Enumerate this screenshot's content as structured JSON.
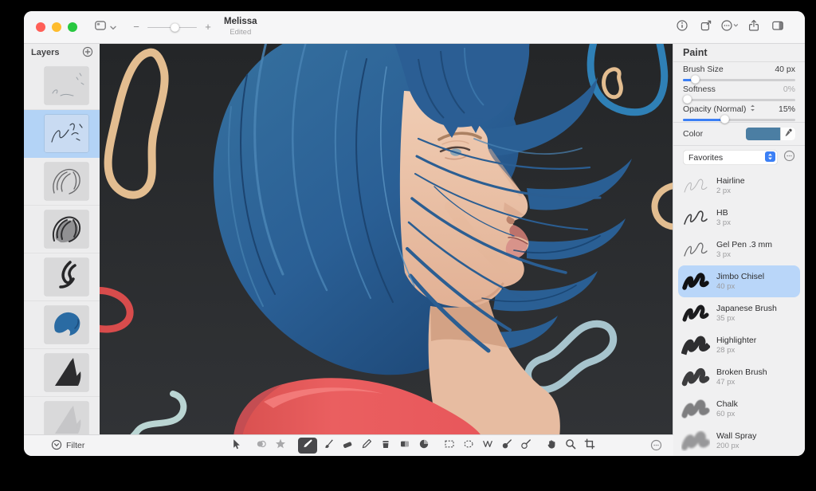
{
  "colors": {
    "accent": "#3b7ff5",
    "selection": "#b9d6f9",
    "layer_selection": "#b3d3f6",
    "swatch": "#4b7ea3",
    "canvas_bg": "#2a2c2e",
    "hair_blue": "#2d659c",
    "skin": "#ecc7ae",
    "shirt_red": "#e85a5c",
    "ring_tan": "#e3bd90",
    "ring_blue": "#2f80b6",
    "ring_red": "#d84c4c",
    "ring_lightblue": "#a7c4cd",
    "ring_teal": "#bad5d3"
  },
  "titlebar": {
    "title": "Melissa",
    "status": "Edited",
    "left_icons": [
      "view-options",
      "chevron-down"
    ],
    "zoom": {
      "minus": "−",
      "plus": "+",
      "level_pct": 57
    },
    "right_icons": [
      "info",
      "duplicate",
      "more-options",
      "share",
      "sidebar-toggle"
    ]
  },
  "layers_panel": {
    "header": "Layers",
    "add_icon": "plus-circle",
    "items": [
      {
        "thumb": "sketch-faint",
        "selected": false
      },
      {
        "thumb": "sketch-hair",
        "selected": true
      },
      {
        "thumb": "hair-line-art",
        "selected": false
      },
      {
        "thumb": "hair-dark-art",
        "selected": false
      },
      {
        "thumb": "stroke-swirl",
        "selected": false
      },
      {
        "thumb": "hair-fill-blue",
        "selected": false
      },
      {
        "thumb": "shape-dark",
        "selected": false
      },
      {
        "thumb": "shape-light",
        "selected": false
      }
    ]
  },
  "canvas": {
    "description": "Digital painting: woman in right-facing profile with blue bob haircut and red shirt on dark charcoal background, surrounded by decorative hand-drawn loops (tan, blue, red, light blue, teal)"
  },
  "inspector": {
    "header": "Paint",
    "controls": [
      {
        "label": "Brush Size",
        "value": "40 px",
        "pct": 8,
        "muted_value": false,
        "stepper": false
      },
      {
        "label": "Softness",
        "value": "0%",
        "pct": 0,
        "muted_value": true,
        "stepper": false
      },
      {
        "label": "Opacity (Normal)",
        "value": "15%",
        "pct": 36,
        "muted_value": false,
        "stepper": true
      }
    ],
    "color": {
      "label": "Color",
      "eyedropper_icon": "eyedropper"
    },
    "favorites": {
      "label": "Favorites",
      "stepper_icon": "select-stepper",
      "more_icon": "ellipsis-circle"
    },
    "brushes": [
      {
        "name": "Hairline",
        "size": "2 px",
        "style": "hairline",
        "selected": false
      },
      {
        "name": "HB",
        "size": "3 px",
        "style": "hb",
        "selected": false
      },
      {
        "name": "Gel Pen .3 mm",
        "size": "3 px",
        "style": "gel",
        "selected": false
      },
      {
        "name": "Jimbo Chisel",
        "size": "40 px",
        "style": "chisel",
        "selected": true
      },
      {
        "name": "Japanese Brush",
        "size": "35 px",
        "style": "japanese",
        "selected": false
      },
      {
        "name": "Highlighter",
        "size": "28 px",
        "style": "highlighter",
        "selected": false
      },
      {
        "name": "Broken Brush",
        "size": "47 px",
        "style": "broken",
        "selected": false
      },
      {
        "name": "Chalk",
        "size": "60 px",
        "style": "chalk",
        "selected": false
      },
      {
        "name": "Wall Spray",
        "size": "200 px",
        "style": "spray",
        "selected": false
      }
    ]
  },
  "bottom_bar": {
    "filter_label": "Filter",
    "filter_icon": "filter-circle",
    "more_icon": "ellipsis-circle",
    "selected_tool": "paint",
    "tool_groups": [
      [
        {
          "id": "move",
          "muted": false
        }
      ],
      [
        {
          "id": "adjust",
          "muted": true
        },
        {
          "id": "effects",
          "muted": true
        }
      ],
      [
        {
          "id": "paint",
          "muted": false
        },
        {
          "id": "brush",
          "muted": false
        },
        {
          "id": "eraser",
          "muted": false
        },
        {
          "id": "pencil",
          "muted": false
        },
        {
          "id": "fill",
          "muted": false
        },
        {
          "id": "gradient",
          "muted": false
        },
        {
          "id": "smudge",
          "muted": false
        }
      ],
      [
        {
          "id": "select-rect",
          "muted": false
        },
        {
          "id": "select-ellipse",
          "muted": false
        },
        {
          "id": "select-lasso",
          "muted": false
        },
        {
          "id": "clone",
          "muted": false
        },
        {
          "id": "retouch",
          "muted": false
        }
      ],
      [
        {
          "id": "hand",
          "muted": false
        },
        {
          "id": "zoom",
          "muted": false
        },
        {
          "id": "crop",
          "muted": false
        }
      ]
    ]
  }
}
